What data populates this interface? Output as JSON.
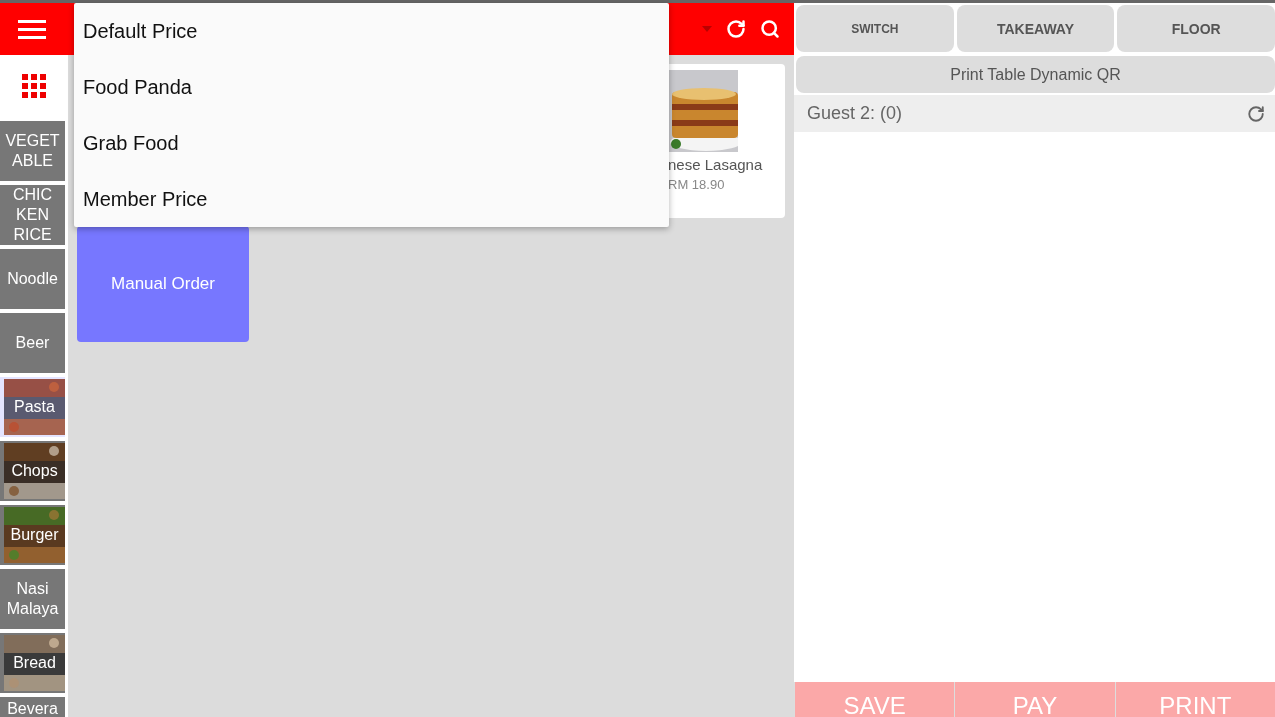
{
  "price_menu": {
    "items": [
      {
        "label": "Default Price"
      },
      {
        "label": "Food Panda"
      },
      {
        "label": "Grab Food"
      },
      {
        "label": "Member Price"
      }
    ]
  },
  "categories": [
    {
      "label": "VEGET ABLE",
      "kind": "plain",
      "selected": false
    },
    {
      "label": "CHIC KEN RICE",
      "kind": "plain",
      "selected": false
    },
    {
      "label": "Noodle",
      "kind": "plain",
      "selected": false
    },
    {
      "label": "Beer",
      "kind": "plain",
      "selected": false
    },
    {
      "label": "Pasta",
      "selected": true
    },
    {
      "label": "Chops",
      "selected": false
    },
    {
      "label": "Burger",
      "selected": false
    },
    {
      "label": "Nasi Malaya",
      "kind": "plain",
      "selected": false
    },
    {
      "label": "Bread",
      "selected": false
    },
    {
      "label": "Bevera",
      "kind": "plain",
      "selected": false
    }
  ],
  "products": [
    {
      "name": "nese Lasagna",
      "price": "RM 18.90"
    }
  ],
  "manual_order": "Manual Order",
  "top_buttons": [
    "SWITCH",
    "TAKEAWAY",
    "FLOOR"
  ],
  "print_qr": "Print Table Dynamic QR",
  "guest": "Guest 2: (0)",
  "bottom_buttons": [
    "SAVE",
    "PAY",
    "PRINT"
  ]
}
